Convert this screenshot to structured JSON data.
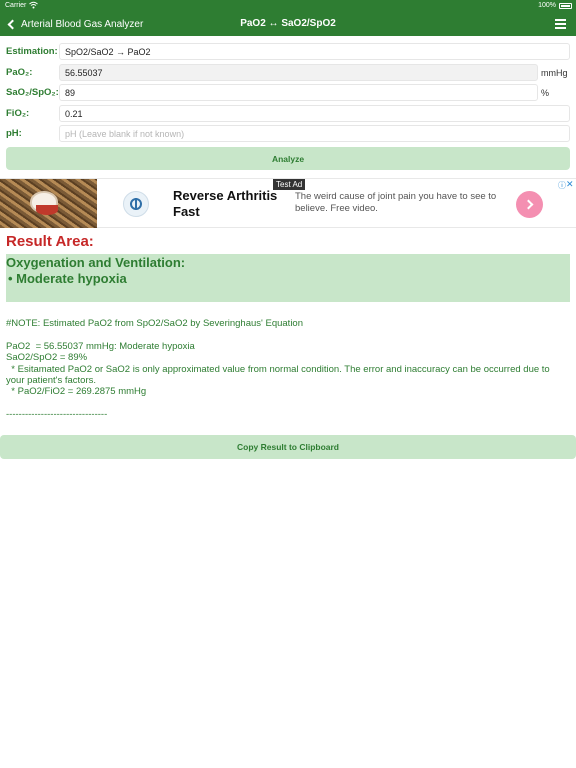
{
  "status_bar": {
    "carrier": "Carrier",
    "battery": "100%"
  },
  "nav": {
    "back_label": "Arterial Blood Gas Analyzer",
    "title": "PaO2 ↔ SaO2/SpO2"
  },
  "form": {
    "estimation": {
      "label": "Estimation:",
      "value": "SpO2/SaO2 → PaO2"
    },
    "pao2": {
      "label": "PaO₂:",
      "value": "56.55037",
      "unit": "mmHg"
    },
    "sao2": {
      "label": "SaO₂/SpO₂:",
      "value": "89",
      "unit": "%"
    },
    "fio2": {
      "label": "FiO₂:",
      "value": "0.21"
    },
    "ph": {
      "label": "pH:",
      "value": "",
      "placeholder": "pH (Leave blank if not known)"
    },
    "analyze_label": "Analyze"
  },
  "ad": {
    "badge": "Test Ad",
    "headline": "Reverse Arthritis Fast",
    "body": "The weird cause of joint pain you have to see to believe. Free video.",
    "info_icon": "info-icon",
    "close_icon": "close-icon"
  },
  "result": {
    "title": "Result Area:",
    "box_heading": "Oxygenation and Ventilation:",
    "box_item": "• Moderate hypoxia",
    "text": "#NOTE: Estimated PaO2 from SpO2/SaO2 by Severinghaus' Equation\n\nPaO2  = 56.55037 mmHg: Moderate hypoxia\nSaO2/SpO2 = 89%\n  * Esitamated PaO2 or SaO2 is only approximated value from normal condition. The error and inaccuracy can be occurred due to your patient's factors.\n  * PaO2/FiO2 = 269.2875 mmHg\n\n--------------------------------",
    "copy_label": "Copy Result to Clipboard"
  },
  "colors": {
    "brand_green": "#2e7d32",
    "light_green": "#c8e6c9",
    "result_red": "#c62828"
  }
}
